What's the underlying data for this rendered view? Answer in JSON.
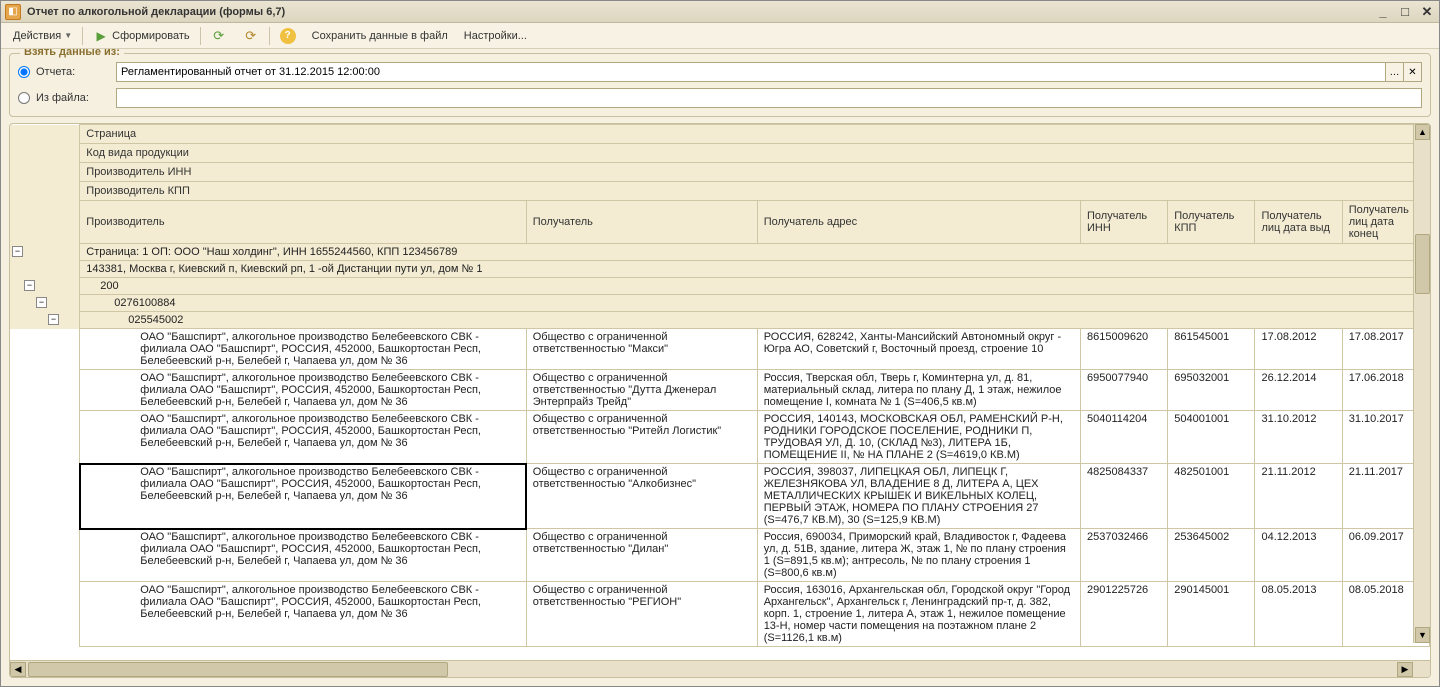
{
  "window": {
    "title": "Отчет по алкогольной декларации (формы 6,7)"
  },
  "toolbar": {
    "actions": "Действия",
    "form": "Сформировать",
    "save_to_file": "Сохранить данные в файл",
    "settings": "Настройки..."
  },
  "source": {
    "legend": "Взять данные из:",
    "radio_report": "Отчета:",
    "radio_file": "Из файла:",
    "report_value": "Регламентированный отчет от 31.12.2015 12:00:00",
    "file_value": ""
  },
  "headers": {
    "page": "Страница",
    "product_code": "Код вида продукции",
    "producer_inn": "Производитель ИНН",
    "producer_kpp": "Производитель КПП",
    "producer": "Производитель",
    "recipient": "Получатель",
    "recipient_addr": "Получатель адрес",
    "recipient_inn": "Получатель ИНН",
    "recipient_kpp": "Получатель КПП",
    "recipient_date_issued": "Получатель лиц дата выд",
    "recipient_date_end": "Получатель лиц дата конец"
  },
  "groups": {
    "page_row": "Страница: 1 ОП: ООО \"Наш холдинг\", ИНН 1655244560, КПП 123456789",
    "addr_row": "143381, Москва г, Киевский п, Киевский рп, 1 -ой Дистанции пути ул, дом № 1",
    "code": "200",
    "inn": "0276100884",
    "kpp": "025545002"
  },
  "producer_text": "ОАО \"Башспирт\", алкогольное производство Белебеевского СВК - филиала ОАО \"Башспирт\", РОССИЯ, 452000, Башкортостан Респ, Белебеевский р-н, Белебей г, Чапаева ул, дом № 36",
  "rows": [
    {
      "recipient": "Общество с ограниченной ответственностью \"Макси\"",
      "addr": "РОССИЯ, 628242, Ханты-Мансийский Автономный округ - Югра АО, Советский г, Восточный проезд, строение 10",
      "inn": "8615009620",
      "kpp": "861545001",
      "d1": "17.08.2012",
      "d2": "17.08.2017"
    },
    {
      "recipient": "Общество с ограниченной ответственностью \"Дутта Дженерал Энтерпрайз Трейд\"",
      "addr": "Россия, Тверская обл, Тверь г, Коминтерна ул, д. 81, материальный склад, литера по плану Д, 1 этаж, нежилое помещение I, комната № 1 (S=406,5 кв.м)",
      "inn": "6950077940",
      "kpp": "695032001",
      "d1": "26.12.2014",
      "d2": "17.06.2018"
    },
    {
      "recipient": "Общество с ограниченной ответственностью  \"Ритейл Логистик\"",
      "addr": "РОССИЯ, 140143, МОСКОВСКАЯ ОБЛ, РАМЕНСКИЙ Р-Н, РОДНИКИ ГОРОДСКОЕ ПОСЕЛЕНИЕ, РОДНИКИ П, ТРУДОВАЯ УЛ, Д. 10, (СКЛАД №3), ЛИТЕРА 1Б, ПОМЕЩЕНИЕ II, № НА ПЛАНЕ 2 (S=4619,0 КВ.М)",
      "inn": "5040114204",
      "kpp": "504001001",
      "d1": "31.10.2012",
      "d2": "31.10.2017"
    },
    {
      "recipient": "Общество с ограниченной ответственностью \"Алкобизнес\"",
      "addr": "РОССИЯ, 398037, ЛИПЕЦКАЯ ОБЛ, ЛИПЕЦК Г, ЖЕЛЕЗНЯКОВА УЛ, ВЛАДЕНИЕ 8 Д, ЛИТЕРА А, ЦЕХ МЕТАЛЛИЧЕСКИХ КРЫШЕК И ВИКЕЛЬНЫХ КОЛЕЦ, ПЕРВЫЙ ЭТАЖ, НОМЕРА ПО ПЛАНУ СТРОЕНИЯ 27 (S=476,7 КВ.М), 30 (S=125,9 КВ.М)",
      "inn": "4825084337",
      "kpp": "482501001",
      "d1": "21.11.2012",
      "d2": "21.11.2017",
      "selected": true
    },
    {
      "recipient": "Общество с ограниченной ответственностью \"Дилан\"",
      "addr": "Россия, 690034, Приморский край, Владивосток г, Фадеева ул, д. 51В, здание, литера Ж, этаж 1, № по плану строения 1 (S=891,5 кв.м); антресоль, № по плану строения 1 (S=800,6 кв.м)",
      "inn": "2537032466",
      "kpp": "253645002",
      "d1": "04.12.2013",
      "d2": "06.09.2017"
    },
    {
      "recipient": "Общество с ограниченной ответственностью \"РЕГИОН\"",
      "addr": "Россия, 163016, Архангельская обл, Городской округ \"Город Архангельск\", Архангельск г, Ленинградский пр-т, д. 382, корп. 1, строение 1, литера А, этаж 1, нежилое помещение 13-Н, номер части помещения на поэтажном плане 2 (S=1126,1 кв.м)",
      "inn": "2901225726",
      "kpp": "290145001",
      "d1": "08.05.2013",
      "d2": "08.05.2018"
    }
  ]
}
